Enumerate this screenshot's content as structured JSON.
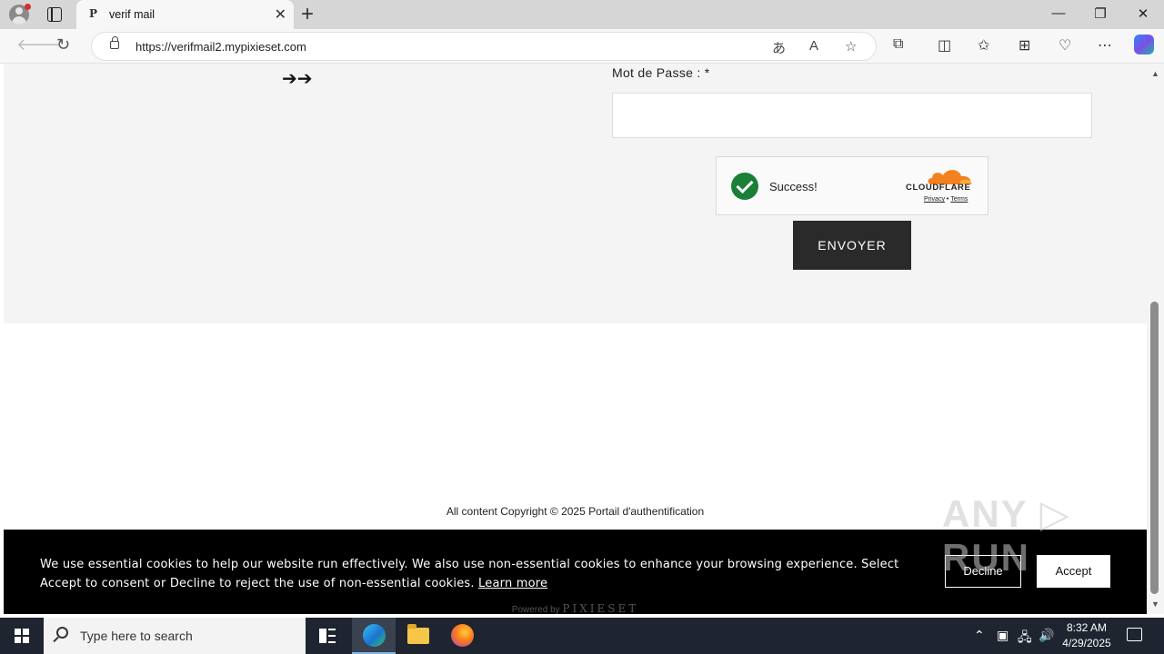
{
  "browser": {
    "tab_title": "verif mail",
    "tab_favicon": "P",
    "url_host": "https://verifmail2.mypixieset.com",
    "close_tab": "✕",
    "new_tab": "+",
    "minimize": "—",
    "restore": "❐",
    "close_window": "✕"
  },
  "form": {
    "arrows": "➔➔",
    "password_label": "Mot de Passe : *",
    "password_value": "",
    "captcha_status": "Success!",
    "captcha_brand": "CLOUDFLARE",
    "captcha_privacy": "Privacy",
    "captcha_sep": " • ",
    "captcha_terms": "Terms",
    "submit_label": "ENVOYER"
  },
  "footer": {
    "copyright": "All content Copyright © 2025 Portail d'authentification",
    "powered_prefix": "Powered by ",
    "powered_brand": "PIXIESET"
  },
  "cookie_banner": {
    "text": "We use essential cookies to help our website run effectively. We also use non-essential cookies to enhance your browsing experience. Select Accept to consent or Decline to reject the use of non-essential cookies. ",
    "learn_more": "Learn more",
    "decline": "Decline",
    "accept": "Accept"
  },
  "watermark": "ANY ▷ RUN",
  "taskbar": {
    "search_placeholder": "Type here to search",
    "time": "8:32 AM",
    "date": "4/29/2025"
  },
  "colors": {
    "accent_button": "#2a2a2a",
    "captcha_success": "#1a7f37",
    "cloudflare_orange": "#f48120",
    "taskbar": "#1e2530"
  }
}
